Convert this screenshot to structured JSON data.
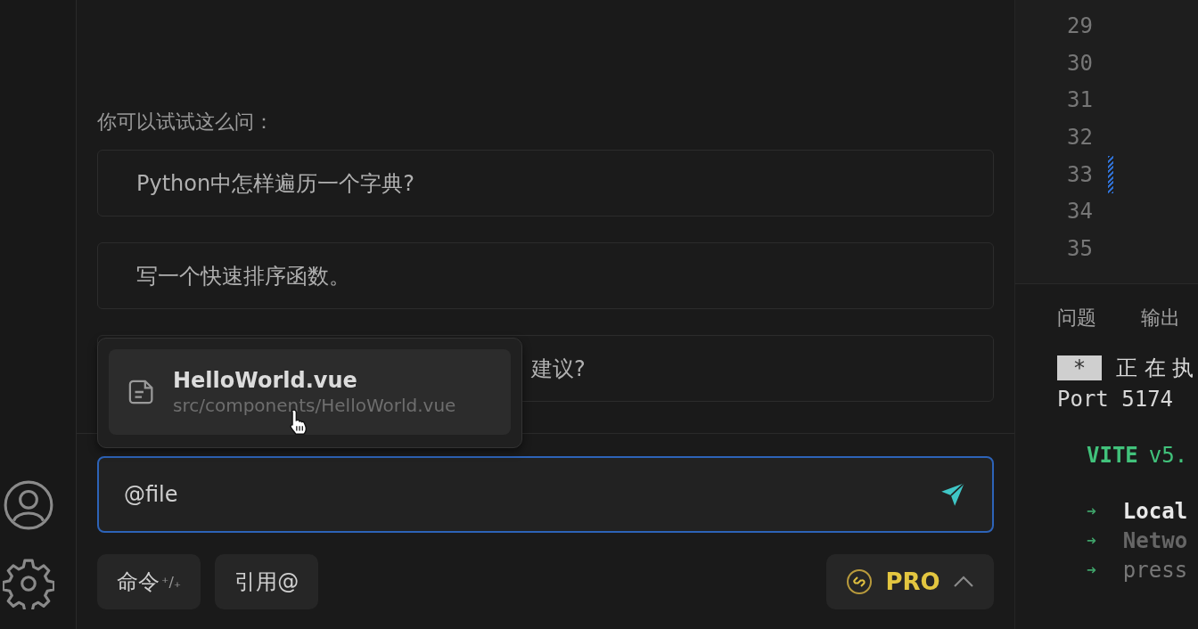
{
  "sidebar": {
    "items": [
      {
        "kind": "account"
      },
      {
        "kind": "settings"
      }
    ]
  },
  "chat": {
    "prompt_heading": "你可以试试这么问：",
    "suggestions": [
      {
        "text": "Python中怎样遍历一个字典?",
        "covered": false
      },
      {
        "text": "写一个快速排序函数。",
        "covered": false
      },
      {
        "text": "建议?",
        "covered": true
      }
    ],
    "file_popup": {
      "items": [
        {
          "name": "HelloWorld.vue",
          "path": "src/components/HelloWorld.vue",
          "selected": true
        }
      ]
    },
    "input": {
      "value": "@file",
      "focused": true
    },
    "buttons": [
      {
        "label": "命令",
        "hint": "⁺/₊"
      },
      {
        "label": "引用@"
      }
    ],
    "plan": {
      "label": "PRO",
      "expanded": false
    }
  },
  "editor": {
    "lines": [
      {
        "number": "29",
        "modified": false
      },
      {
        "number": "30",
        "modified": false
      },
      {
        "number": "31",
        "modified": false
      },
      {
        "number": "32",
        "modified": false
      },
      {
        "number": "33",
        "modified": true
      },
      {
        "number": "34",
        "modified": false
      },
      {
        "number": "35",
        "modified": false
      }
    ]
  },
  "panel": {
    "tabs": [
      {
        "label": "问题",
        "selected": false
      },
      {
        "label": "输出",
        "selected": false
      }
    ],
    "lines": [
      {
        "kind": "task",
        "badge": "*",
        "text": "正 在 执"
      },
      {
        "kind": "plain",
        "text": "Port 5174"
      },
      {
        "kind": "blank"
      },
      {
        "kind": "vite",
        "name": "VITE",
        "version": "v5."
      },
      {
        "kind": "blank"
      },
      {
        "kind": "strong",
        "text": "Local"
      },
      {
        "kind": "muted",
        "text": "Netwo"
      },
      {
        "kind": "faint",
        "text": "press"
      }
    ],
    "arrow": "➜"
  }
}
